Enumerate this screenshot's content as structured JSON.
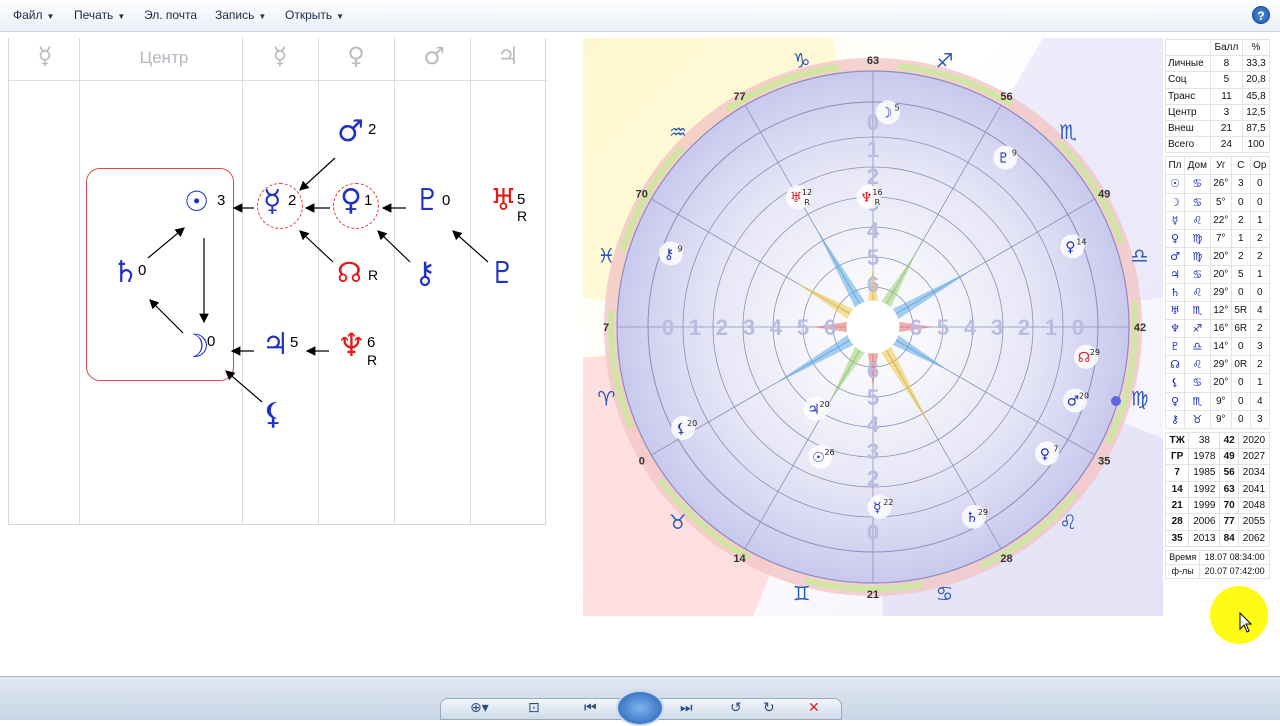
{
  "menu": {
    "file": "Файл",
    "print": "Печать",
    "email": "Эл. почта",
    "record": "Запись",
    "open": "Открыть",
    "help": "?"
  },
  "grid": {
    "headers": [
      "☿",
      "Центр",
      "☿",
      "♀",
      "♂",
      "♃"
    ]
  },
  "diagram": {
    "sun": {
      "glyph": "☉",
      "n": "3"
    },
    "saturn": {
      "glyph": "♄",
      "n": "0"
    },
    "moon": {
      "glyph": "☽",
      "n": "0"
    },
    "mercury": {
      "glyph": "☿",
      "n": "2"
    },
    "venus": {
      "glyph": "♀",
      "n": "1"
    },
    "mars": {
      "glyph": "♂",
      "n": "2"
    },
    "pluto": {
      "glyph": "♇",
      "n": "0"
    },
    "uranus": {
      "glyph": "♅",
      "n": "5",
      "r": "R"
    },
    "node": {
      "glyph": "☊",
      "r": "R"
    },
    "chiron": {
      "glyph": "⚷"
    },
    "pluto2": {
      "glyph": "♇"
    },
    "jupiter": {
      "glyph": "♃",
      "n": "5"
    },
    "neptune": {
      "glyph": "♆",
      "n": "6",
      "r": "R"
    },
    "lilith": {
      "glyph": "⚸"
    }
  },
  "wheel": {
    "ring_numbers": [
      "63",
      "56",
      "49",
      "42",
      "35",
      "28",
      "21",
      "14",
      "0",
      "7",
      "70",
      "77"
    ],
    "zodiac": [
      "♐",
      "♏",
      "♎",
      "♍",
      "♌",
      "♋",
      "♊",
      "♉",
      "♈",
      "♓",
      "♒",
      "♑"
    ],
    "inner_numbers": [
      "0",
      "1",
      "2",
      "3",
      "4",
      "5",
      "6"
    ],
    "planets": [
      {
        "g": "☽",
        "n": "5"
      },
      {
        "g": "♇",
        "n": "9"
      },
      {
        "g": "♀",
        "n": "14"
      },
      {
        "g": "☊",
        "n": "29"
      },
      {
        "g": "♂",
        "n": "20"
      },
      {
        "g": "♀",
        "n": "7"
      },
      {
        "g": "♄",
        "n": "29"
      },
      {
        "g": "☿",
        "n": "22"
      },
      {
        "g": "☉",
        "n": "26"
      },
      {
        "g": "♃",
        "n": "20"
      },
      {
        "g": "⚸",
        "n": "20"
      },
      {
        "g": "⚷",
        "n": "9"
      },
      {
        "g": "♆",
        "n": "16",
        "r": "R"
      },
      {
        "g": "♅",
        "n": "12",
        "r": "R"
      }
    ]
  },
  "stats": {
    "header": [
      "",
      "Балл",
      "%"
    ],
    "rows": [
      [
        "Личные",
        "8",
        "33,3"
      ],
      [
        "Соц",
        "5",
        "20,8"
      ],
      [
        "Транс",
        "11",
        "45,8"
      ],
      [
        "Центр",
        "3",
        "12,5"
      ],
      [
        "Внеш",
        "21",
        "87,5"
      ],
      [
        "Всего",
        "24",
        "100"
      ]
    ]
  },
  "planets_table": {
    "header": [
      "Пл",
      "Дом",
      "Уг",
      "С",
      "Ор"
    ],
    "rows": [
      [
        "☉",
        "♋",
        "26°",
        "3",
        "0"
      ],
      [
        "☽",
        "♋",
        "5°",
        "0",
        "0"
      ],
      [
        "☿",
        "♌",
        "22°",
        "2",
        "1"
      ],
      [
        "♀",
        "♍",
        "7°",
        "1",
        "2"
      ],
      [
        "♂",
        "♍",
        "20°",
        "2",
        "2"
      ],
      [
        "♃",
        "♋",
        "20°",
        "5",
        "1"
      ],
      [
        "♄",
        "♌",
        "29°",
        "0",
        "0"
      ],
      [
        "♅",
        "♏",
        "12°",
        "5R",
        "4"
      ],
      [
        "♆",
        "♐",
        "16°",
        "6R",
        "2"
      ],
      [
        "♇",
        "♎",
        "14°",
        "0",
        "3"
      ],
      [
        "☊",
        "♌",
        "29°",
        "0R",
        "2"
      ],
      [
        "⚸",
        "♋",
        "20°",
        "0",
        "1"
      ],
      [
        "♀",
        "♏",
        "9°",
        "0",
        "4"
      ],
      [
        "⚷",
        "♉",
        "9°",
        "0",
        "3"
      ]
    ]
  },
  "years_table": {
    "rows": [
      [
        "ТЖ",
        "38",
        "42",
        "2020"
      ],
      [
        "ГР",
        "1978",
        "49",
        "2027"
      ],
      [
        "7",
        "1985",
        "56",
        "2034"
      ],
      [
        "14",
        "1992",
        "63",
        "2041"
      ],
      [
        "21",
        "1999",
        "70",
        "2048"
      ],
      [
        "28",
        "2006",
        "77",
        "2055"
      ],
      [
        "35",
        "2013",
        "84",
        "2062"
      ]
    ]
  },
  "time_table": {
    "rows": [
      [
        "Время",
        "18.07 08:34:00"
      ],
      [
        "ф-лы",
        "20.07 07:42:00"
      ]
    ]
  },
  "toolbar": {
    "zoom": "⊕▾",
    "fit": "⊡",
    "prev": "⏮",
    "next": "⏭",
    "rotl": "↺",
    "rotr": "↻",
    "delete": "✕"
  }
}
